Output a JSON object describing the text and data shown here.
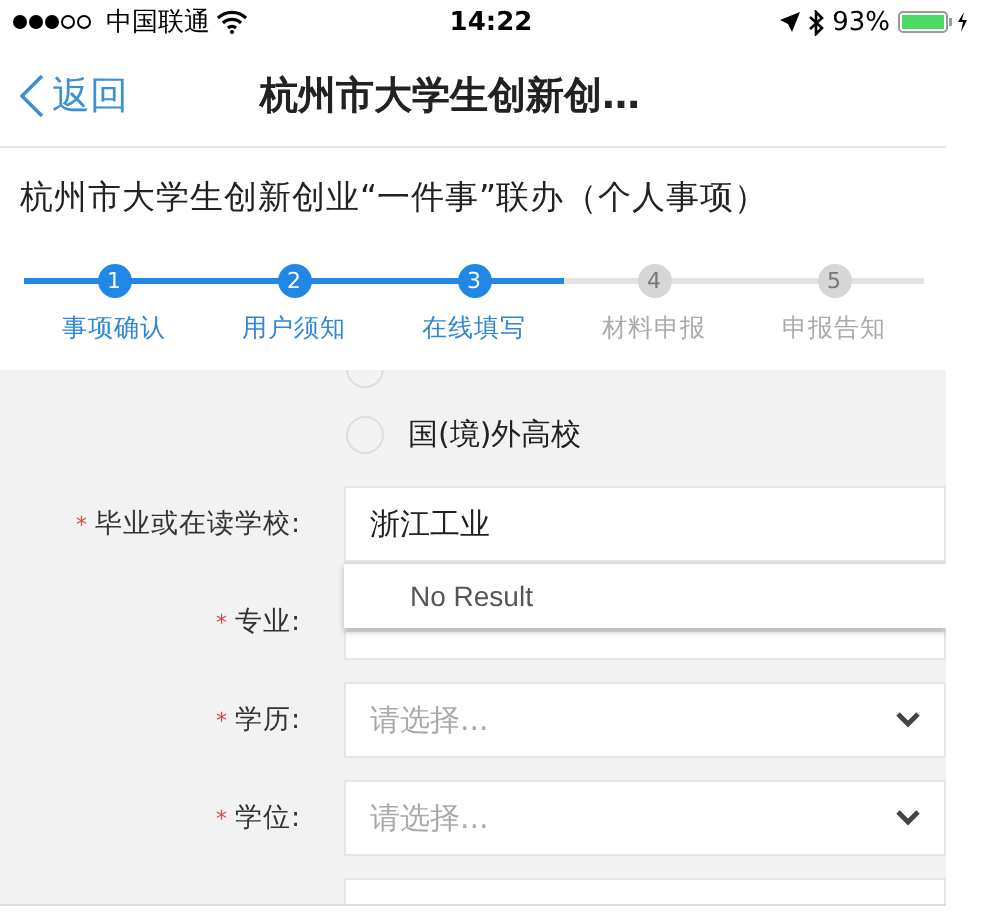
{
  "status_bar": {
    "carrier": "中国联通",
    "time": "14:22",
    "battery": "93%"
  },
  "nav": {
    "back": "返回",
    "title": "杭州市大学生创新创…"
  },
  "heading": "杭州市大学生创新创业“一件事”联办（个人事项）",
  "steps": [
    {
      "number": "1",
      "label": "事项确认",
      "done": true
    },
    {
      "number": "2",
      "label": "用户须知",
      "done": true
    },
    {
      "number": "3",
      "label": "在线填写",
      "done": true
    },
    {
      "number": "4",
      "label": "材料申报",
      "done": false
    },
    {
      "number": "5",
      "label": "申报告知",
      "done": false
    }
  ],
  "form": {
    "radios": [
      {
        "selected": false
      },
      {
        "label": "国(境)外高校",
        "selected": false
      }
    ],
    "fields": [
      {
        "kind": "autocomplete",
        "label": "毕业或在读学校:",
        "marker": "*",
        "value": "浙江工业",
        "suggestion": "No Result"
      },
      {
        "kind": "text",
        "label": "专业:",
        "marker": "*"
      },
      {
        "kind": "select",
        "label": "学历:",
        "marker": "*",
        "placeholder": "请选择..."
      },
      {
        "kind": "select",
        "label": "学位:",
        "marker": "*",
        "placeholder": "请选择..."
      },
      {
        "kind": "text"
      }
    ]
  }
}
